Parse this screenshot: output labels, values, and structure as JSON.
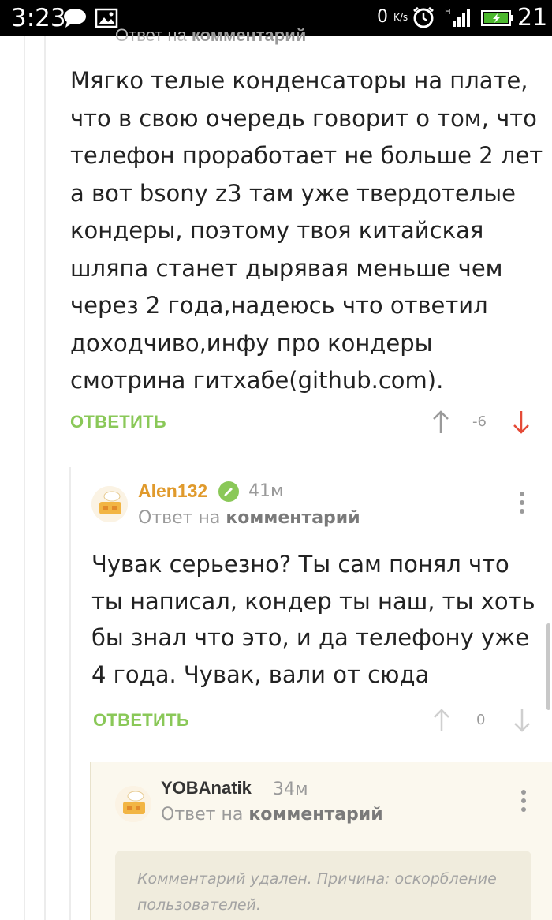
{
  "status_bar": {
    "time": "3:23",
    "network_speed": "0",
    "network_speed_unit": "K/s",
    "battery_level": "21",
    "icons": [
      "chat-bubble-icon",
      "gallery-icon",
      "alarm-icon",
      "signal-icon",
      "battery-icon"
    ]
  },
  "colors": {
    "accent_green": "#8ac858",
    "username_orange": "#e09a2c",
    "downvote_red": "#e54a37",
    "muted_gray": "#9a9a9a",
    "deleted_bg": "#fbf8ee"
  },
  "comments": [
    {
      "reply_to_prefix": "Ответ на",
      "reply_to_link": "комментарий",
      "text": "Мягко телые конденсаторы на плате, что в свою очередь говорит о том, что телефон проработает не больше 2 лет а вот bsony z3 там уже твердотелые кондеры, поэтому твоя китайская шляпа станет дырявая меньше чем через 2 года,надеюсь что ответил доходчиво,инфу про кондеры смотрина гитхабе(github.com).",
      "reply_label": "ОТВЕТИТЬ",
      "rating": "-6",
      "vote_state": "downvoted"
    },
    {
      "username": "Alen132",
      "time_ago": "41м",
      "reply_to_prefix": "Ответ на",
      "reply_to_link": "комментарий",
      "text": "Чувак серьезно? Ты сам понял что ты написал, кондер ты наш, ты хоть бы знал что это, и да телефону уже 4 года. Чувак, вали от сюда",
      "reply_label": "ОТВЕТИТЬ",
      "rating": "0"
    },
    {
      "username": "YOBAnatik",
      "time_ago": "34м",
      "reply_to_prefix": "Ответ на",
      "reply_to_link": "комментарий",
      "deleted_notice": "Комментарий удален. Причина: оскорбление пользователей."
    }
  ]
}
